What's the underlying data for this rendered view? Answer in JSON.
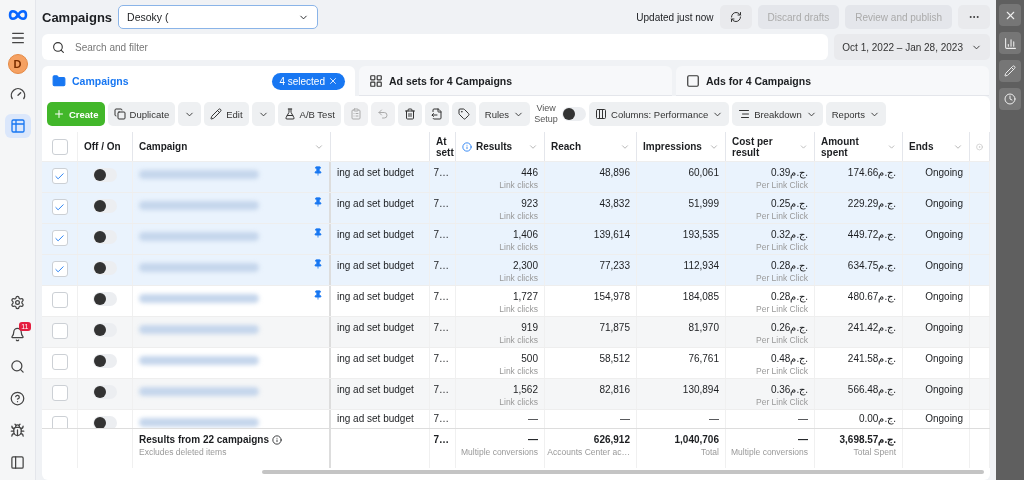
{
  "sidebar": {
    "avatar": "D",
    "items": [
      {
        "kind": "gauge",
        "selected": false
      },
      {
        "kind": "table",
        "selected": true
      }
    ],
    "bottom_items": [
      {
        "kind": "settings"
      },
      {
        "kind": "notifications",
        "badge": "11"
      },
      {
        "kind": "search"
      },
      {
        "kind": "help"
      },
      {
        "kind": "bug"
      },
      {
        "kind": "panel"
      }
    ]
  },
  "header": {
    "title": "Campaigns",
    "account": "Desoky (",
    "status": "Updated just now",
    "buttons": [
      {
        "label": "Discard drafts",
        "disabled": true
      },
      {
        "label": "Review and publish",
        "disabled": true
      }
    ]
  },
  "search": {
    "placeholder": "Search and filter",
    "date_range": "Oct 1, 2022 – Jan 28, 2023"
  },
  "tabs": [
    {
      "kind": "campaigns",
      "label": "Campaigns",
      "selected": true,
      "badge": "4 selected"
    },
    {
      "kind": "adsets",
      "label": "Ad sets for 4 Campaigns",
      "selected": false
    },
    {
      "kind": "ads",
      "label": "Ads for 4 Campaigns",
      "selected": false
    }
  ],
  "toolbar": {
    "create": "Create",
    "duplicate": "Duplicate",
    "edit": "Edit",
    "ab_test": "A/B Test",
    "icon_buttons": [
      {
        "kind": "clipboard",
        "disabled": true
      },
      {
        "kind": "undo",
        "disabled": true
      },
      {
        "kind": "trash",
        "disabled": false
      },
      {
        "kind": "export",
        "disabled": false
      },
      {
        "kind": "tag",
        "disabled": false
      }
    ],
    "rules": "Rules",
    "view_setup": {
      "label": "View Setup",
      "on": false
    },
    "columns": "Columns: Performance",
    "breakdown": "Breakdown",
    "reports": "Reports"
  },
  "table": {
    "all_selected": false,
    "columns": [
      {
        "label": "Off / On"
      },
      {
        "label": "Campaign",
        "caret": true
      },
      {},
      {
        "label": "At sett"
      },
      {
        "label": "Results",
        "caret": true,
        "info": true
      },
      {
        "label": "Reach",
        "caret": true
      },
      {
        "label": "Impressions",
        "caret": true
      },
      {
        "label": "Cost per result",
        "caret": true
      },
      {
        "label": "Amount spent",
        "caret": true
      },
      {
        "label": "Ends",
        "caret": true
      }
    ],
    "rows": [
      {
        "selected": true,
        "on": false,
        "pinned": true,
        "budget": "ing ad set budget",
        "attribution": "7…",
        "results": "446",
        "results_label": "Link clicks",
        "reach": "48,896",
        "impressions": "60,061",
        "cost": "0.39ج.م.",
        "cost_label": "Per Link Click",
        "amount": "174.66ج.م.",
        "ends": "Ongoing"
      },
      {
        "selected": true,
        "on": false,
        "pinned": true,
        "budget": "ing ad set budget",
        "attribution": "7…",
        "results": "923",
        "results_label": "Link clicks",
        "reach": "43,832",
        "impressions": "51,999",
        "cost": "0.25ج.م.",
        "cost_label": "Per Link Click",
        "amount": "229.29ج.م.",
        "ends": "Ongoing"
      },
      {
        "selected": true,
        "on": false,
        "pinned": true,
        "budget": "ing ad set budget",
        "attribution": "7…",
        "results": "1,406",
        "results_label": "Link clicks",
        "reach": "139,614",
        "impressions": "193,535",
        "cost": "0.32ج.م.",
        "cost_label": "Per Link Click",
        "amount": "449.72ج.م.",
        "ends": "Ongoing"
      },
      {
        "selected": true,
        "on": false,
        "pinned": true,
        "budget": "ing ad set budget",
        "attribution": "7…",
        "results": "2,300",
        "results_label": "Link clicks",
        "reach": "77,233",
        "impressions": "112,934",
        "cost": "0.28ج.م.",
        "cost_label": "Per Link Click",
        "amount": "634.75ج.م.",
        "ends": "Ongoing"
      },
      {
        "selected": false,
        "on": false,
        "pinned": true,
        "budget": "ing ad set budget",
        "attribution": "7…",
        "results": "1,727",
        "results_label": "Link clicks",
        "reach": "154,978",
        "impressions": "184,085",
        "cost": "0.28ج.م.",
        "cost_label": "Per Link Click",
        "amount": "480.67ج.م.",
        "ends": "Ongoing"
      },
      {
        "selected": false,
        "on": false,
        "pinned": false,
        "budget": "ing ad set budget",
        "attribution": "7…",
        "results": "919",
        "results_label": "Link clicks",
        "reach": "71,875",
        "impressions": "81,970",
        "cost": "0.26ج.م.",
        "cost_label": "Per Link Click",
        "amount": "241.42ج.م.",
        "ends": "Ongoing"
      },
      {
        "selected": false,
        "on": false,
        "pinned": false,
        "budget": "ing ad set budget",
        "attribution": "7…",
        "results": "500",
        "results_label": "Link clicks",
        "reach": "58,512",
        "impressions": "76,761",
        "cost": "0.48ج.م.",
        "cost_label": "Per Link Click",
        "amount": "241.58ج.م.",
        "ends": "Ongoing"
      },
      {
        "selected": false,
        "on": false,
        "pinned": false,
        "budget": "ing ad set budget",
        "attribution": "7…",
        "results": "1,562",
        "results_label": "Link clicks",
        "reach": "82,816",
        "impressions": "130,894",
        "cost": "0.36ج.م.",
        "cost_label": "Per Link Click",
        "amount": "566.48ج.م.",
        "ends": "Ongoing"
      },
      {
        "selected": false,
        "on": false,
        "pinned": false,
        "budget": "ing ad set budget",
        "attribution": "7…",
        "results": "—",
        "reach": "—",
        "impressions": "—",
        "cost": "—",
        "amount": "0.00ج.م.",
        "ends": "Ongoing"
      }
    ],
    "footer": {
      "title": "Results from 22 campaigns",
      "note": "Excludes deleted items",
      "attribution": "7…",
      "results": "—",
      "results_label": "Multiple conversions",
      "reach": "626,912",
      "reach_label": "Accounts Center ac…",
      "impressions": "1,040,706",
      "impressions_label": "Total",
      "cost": "—",
      "cost_label": "Multiple conversions",
      "amount": "3,698.57ج.م.",
      "amount_label": "Total Spent"
    }
  }
}
